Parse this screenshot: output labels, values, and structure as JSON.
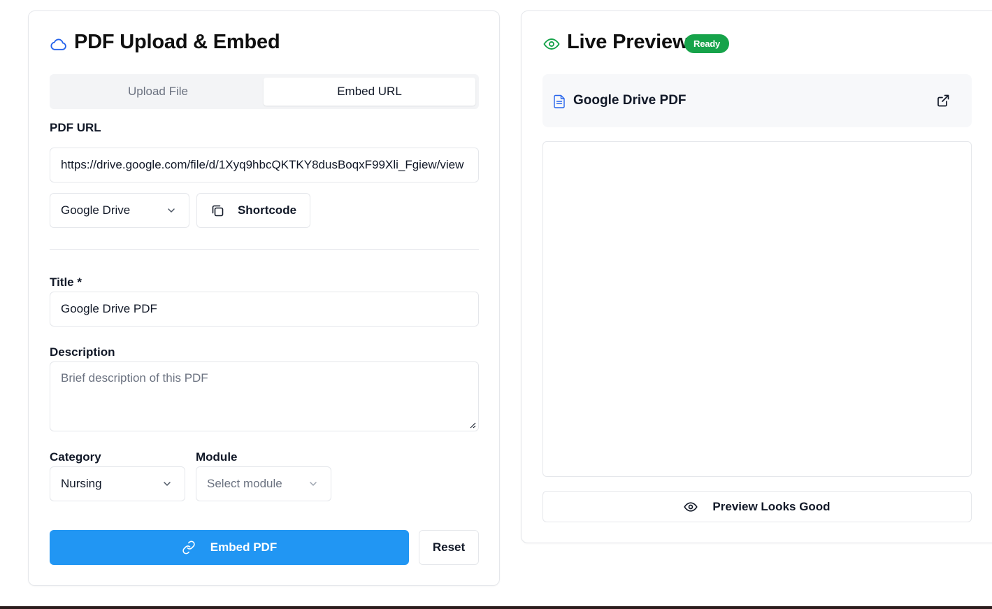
{
  "upload_card": {
    "title": "PDF Upload & Embed",
    "title_icon": "cloud-icon",
    "tabs": [
      {
        "label": "Upload File",
        "active": false
      },
      {
        "label": "Embed URL",
        "active": true
      }
    ],
    "pdf_url": {
      "label": "PDF URL",
      "value": "https://drive.google.com/file/d/1Xyq9hbcQKTKY8dusBoqxF99Xli_Fgiew/view"
    },
    "source_select": {
      "value": "Google Drive",
      "icon": "chevron-down-icon"
    },
    "shortcode_button": {
      "label": "Shortcode",
      "icon": "copy-icon"
    },
    "title_field": {
      "label": "Title *",
      "value": "Google Drive PDF"
    },
    "description_field": {
      "label": "Description",
      "placeholder": "Brief description of this PDF"
    },
    "category": {
      "label": "Category",
      "value": "Nursing"
    },
    "module": {
      "label": "Module",
      "placeholder": "Select module"
    },
    "embed_button": {
      "label": "Embed PDF",
      "icon": "link-icon"
    },
    "reset_button": {
      "label": "Reset"
    }
  },
  "preview_card": {
    "title": "Live Preview",
    "title_icon": "eye-icon",
    "status_badge": "Ready",
    "document": {
      "name": "Google Drive PDF",
      "icon": "file-text-icon",
      "open_icon": "external-link-icon"
    },
    "confirm_button": {
      "label": "Preview Looks Good",
      "icon": "eye-icon"
    }
  },
  "colors": {
    "primary": "#2196f3",
    "success": "#16a34a",
    "border": "#e5e7eb",
    "muted_text": "#6b7280"
  }
}
